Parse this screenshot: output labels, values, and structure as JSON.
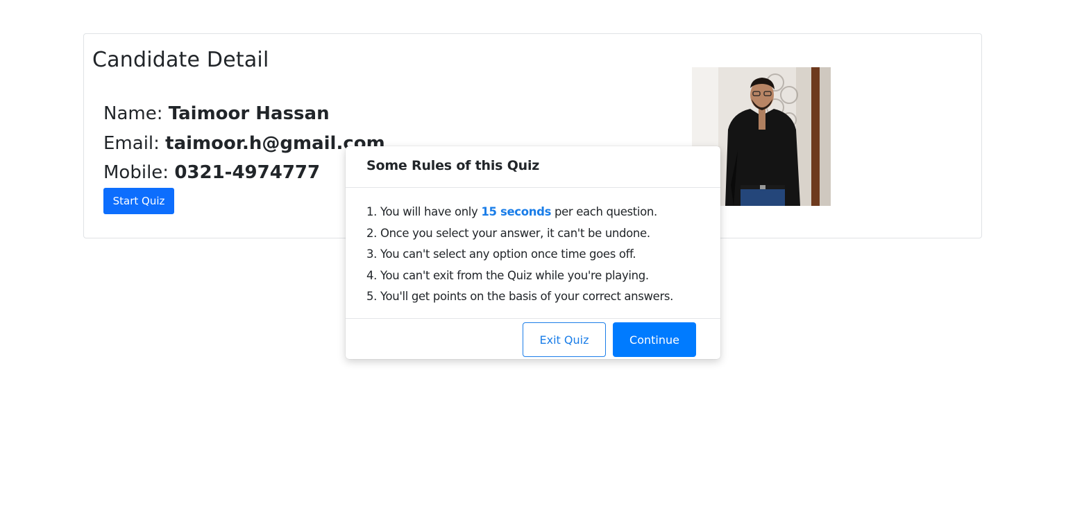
{
  "candidate": {
    "title": "Candidate Detail",
    "name_label": "Name: ",
    "name_value": "Taimoor Hassan",
    "email_label": "Email: ",
    "email_value": "taimoor.h@gmail.com",
    "mobile_label": "Mobile: ",
    "mobile_value": "0321-4974777",
    "start_button": "Start Quiz",
    "photo_alt": "Candidate photo"
  },
  "modal": {
    "title": "Some Rules of this Quiz",
    "rules": [
      {
        "prefix": "1. You will have only ",
        "highlight": "15 seconds",
        "suffix": " per each question."
      },
      {
        "text": "2. Once you select your answer, it can't be undone."
      },
      {
        "text": "3. You can't select any option once time goes off."
      },
      {
        "text": "4. You can't exit from the Quiz while you're playing."
      },
      {
        "text": "5. You'll get points on the basis of your correct answers."
      }
    ],
    "exit_button": "Exit Quiz",
    "continue_button": "Continue"
  },
  "colors": {
    "primary": "#0d6efd",
    "accent": "#007bff",
    "highlight": "#1a7de8"
  }
}
